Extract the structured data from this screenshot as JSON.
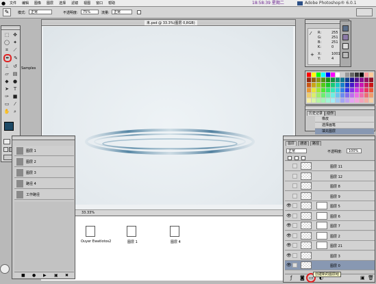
{
  "menubar": {
    "items": [
      "文件",
      "编辑",
      "图像",
      "图层",
      "选择",
      "滤镜",
      "视图",
      "窗口",
      "帮助"
    ],
    "clock": "18:58:39 星期二",
    "app": "Adobe Photoshop® 6.0.1"
  },
  "options": {
    "mode_label": "模式:",
    "mode_value": "正常",
    "opacity_label": "不透明度:",
    "opacity_value": "75%",
    "flow_label": "流量:",
    "flow_value": "正常"
  },
  "document": {
    "title": "未.psd @ 33.3%(图层 0,RGB)",
    "status": "33.33%"
  },
  "desktop": {
    "icon1": "Ouyer Ewatlotos2",
    "icon2": "图层 1",
    "icon3": "图层 4"
  },
  "sample_label": "Samples",
  "info": {
    "rows": [
      {
        "k": "R:",
        "v": "255"
      },
      {
        "k": "G:",
        "v": "251"
      },
      {
        "k": "B:",
        "v": "251"
      },
      {
        "k": "K:",
        "v": "0"
      },
      {
        "k": "X:",
        "v": "1001"
      },
      {
        "k": "Y:",
        "v": "4"
      }
    ]
  },
  "history": {
    "tabs": [
      "历史记录",
      "动作"
    ],
    "rows": [
      "橡皮",
      "选择画笔",
      "填充图层"
    ]
  },
  "actions": {
    "rows": [
      "图层 1",
      "图层 2",
      "图层 3",
      "路径 4",
      "工作路径"
    ]
  },
  "layers": {
    "tabs": [
      "图层",
      "通道",
      "路径"
    ],
    "blend": "正常",
    "opacity_label": "不透明度:",
    "opacity": "100%",
    "rows": [
      "图层 11",
      "图层 12",
      "图层 8",
      "图层 9",
      "图层 5",
      "图层 6",
      "图层 7",
      "图层 2",
      "图层 21",
      "图层 3",
      "图层 0"
    ]
  },
  "tooltip": "创建新的图层组"
}
